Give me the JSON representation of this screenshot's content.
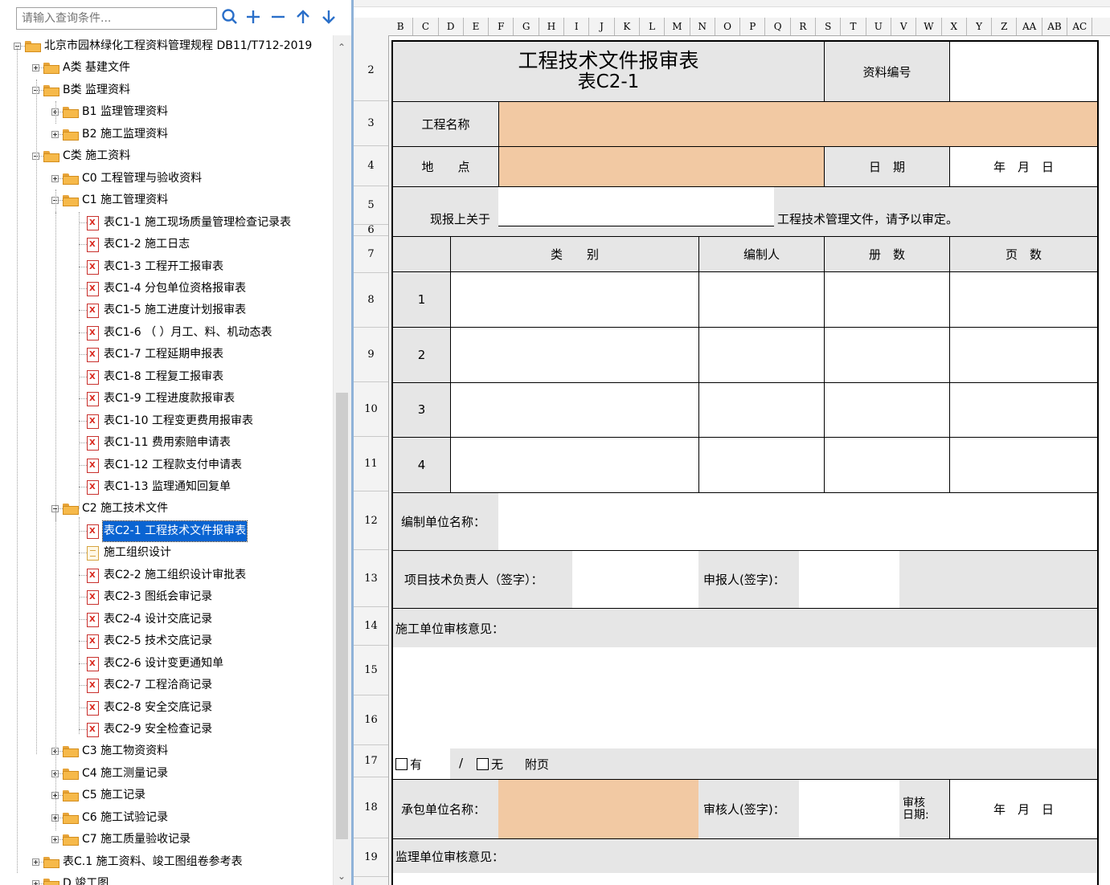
{
  "search": {
    "placeholder": "请输入查询条件..."
  },
  "toolbar": {
    "icons": [
      "search-icon",
      "add-icon",
      "remove-icon",
      "move-up-icon",
      "move-down-icon"
    ],
    "buttons": [
      "搜索",
      "添加",
      "删除",
      "上移",
      "下移"
    ]
  },
  "tree": {
    "nodes": [
      {
        "label": "北京市园林绿化工程资料管理规程 DB11/T712-2019",
        "level": 0,
        "icon": "folder-open-icon",
        "expanded": true
      },
      {
        "label": "A类 基建文件",
        "level": 1,
        "icon": "folder-icon",
        "expanded": false
      },
      {
        "label": "B类 监理资料",
        "level": 1,
        "icon": "folder-open-icon",
        "expanded": true
      },
      {
        "label": "B1 监理管理资料",
        "level": 2,
        "icon": "folder-icon",
        "expanded": false
      },
      {
        "label": "B2 施工监理资料",
        "level": 2,
        "icon": "folder-icon",
        "expanded": false
      },
      {
        "label": "C类 施工资料",
        "level": 1,
        "icon": "folder-open-icon",
        "expanded": true
      },
      {
        "label": "C0 工程管理与验收资料",
        "level": 2,
        "icon": "folder-icon",
        "expanded": false
      },
      {
        "label": "C1 施工管理资料",
        "level": 2,
        "icon": "folder-open-icon",
        "expanded": true
      },
      {
        "label": "表C1-1 施工现场质量管理检查记录表",
        "level": 3,
        "icon": "pdf-icon"
      },
      {
        "label": "表C1-2 施工日志",
        "level": 3,
        "icon": "pdf-icon"
      },
      {
        "label": "表C1-3 工程开工报审表",
        "level": 3,
        "icon": "pdf-icon"
      },
      {
        "label": "表C1-4 分包单位资格报审表",
        "level": 3,
        "icon": "pdf-icon"
      },
      {
        "label": "表C1-5 施工进度计划报审表",
        "level": 3,
        "icon": "pdf-icon"
      },
      {
        "label": "表C1-6 （ ）月工、料、机动态表",
        "level": 3,
        "icon": "pdf-icon"
      },
      {
        "label": "表C1-7 工程延期申报表",
        "level": 3,
        "icon": "pdf-icon"
      },
      {
        "label": "表C1-8 工程复工报审表",
        "level": 3,
        "icon": "pdf-icon"
      },
      {
        "label": "表C1-9 工程进度款报审表",
        "level": 3,
        "icon": "pdf-icon"
      },
      {
        "label": "表C1-10 工程变更费用报审表",
        "level": 3,
        "icon": "pdf-icon"
      },
      {
        "label": "表C1-11 费用索赔申请表",
        "level": 3,
        "icon": "pdf-icon"
      },
      {
        "label": "表C1-12 工程款支付申请表",
        "level": 3,
        "icon": "pdf-icon"
      },
      {
        "label": "表C1-13 监理通知回复单",
        "level": 3,
        "icon": "pdf-icon"
      },
      {
        "label": "C2 施工技术文件",
        "level": 2,
        "icon": "folder-open-icon",
        "expanded": true
      },
      {
        "label": "表C2-1 工程技术文件报审表",
        "level": 3,
        "icon": "pdf-icon",
        "selected": true
      },
      {
        "label": "施工组织设计",
        "level": 3,
        "icon": "document-icon"
      },
      {
        "label": "表C2-2 施工组织设计审批表",
        "level": 3,
        "icon": "pdf-icon"
      },
      {
        "label": "表C2-3 图纸会审记录",
        "level": 3,
        "icon": "pdf-icon"
      },
      {
        "label": "表C2-4 设计交底记录",
        "level": 3,
        "icon": "pdf-icon"
      },
      {
        "label": "表C2-5 技术交底记录",
        "level": 3,
        "icon": "pdf-icon"
      },
      {
        "label": "表C2-6 设计变更通知单",
        "level": 3,
        "icon": "pdf-icon"
      },
      {
        "label": "表C2-7 工程洽商记录",
        "level": 3,
        "icon": "pdf-icon"
      },
      {
        "label": "表C2-8 安全交底记录",
        "level": 3,
        "icon": "pdf-icon"
      },
      {
        "label": "表C2-9 安全检查记录",
        "level": 3,
        "icon": "pdf-icon"
      },
      {
        "label": "C3 施工物资资料",
        "level": 2,
        "icon": "folder-icon",
        "expanded": false
      },
      {
        "label": "C4 施工测量记录",
        "level": 2,
        "icon": "folder-icon",
        "expanded": false
      },
      {
        "label": "C5 施工记录",
        "level": 2,
        "icon": "folder-icon",
        "expanded": false
      },
      {
        "label": "C6 施工试验记录",
        "level": 2,
        "icon": "folder-icon",
        "expanded": false
      },
      {
        "label": "C7 施工质量验收记录",
        "level": 2,
        "icon": "folder-icon",
        "expanded": false
      },
      {
        "label": "表C.1 施工资料、竣工图组卷参考表",
        "level": 1,
        "icon": "folder-icon",
        "expanded": false
      },
      {
        "label": "D 竣工图",
        "level": 1,
        "icon": "folder-icon",
        "expanded": false
      }
    ]
  },
  "sheet": {
    "columns": [
      "B",
      "C",
      "D",
      "E",
      "F",
      "G",
      "H",
      "I",
      "J",
      "K",
      "L",
      "M",
      "N",
      "O",
      "P",
      "Q",
      "R",
      "S",
      "T",
      "U",
      "V",
      "W",
      "X",
      "Y",
      "Z",
      "AA",
      "AB",
      "AC"
    ],
    "rows": [
      "2",
      "3",
      "4",
      "5",
      "6",
      "7",
      "8",
      "9",
      "10",
      "11",
      "12",
      "13",
      "14",
      "15",
      "16",
      "17",
      "18",
      "19"
    ]
  },
  "form": {
    "title": "工程技术文件报审表",
    "subtitle": "表C2-1",
    "doc_no_label": "资料编号",
    "project_name_label": "工程名称",
    "location_label": "地　　点",
    "date_label": "日　期",
    "date_placeholder": "年　月　日",
    "report_prefix": "现报上关于",
    "report_suffix": "工程技术管理文件，请予以审定。",
    "headers": {
      "index": "",
      "category": "类　　别",
      "author": "编制人",
      "volumes": "册　数",
      "pages": "页　数"
    },
    "items": [
      "1",
      "2",
      "3",
      "4"
    ],
    "compile_unit_label": "编制单位名称：",
    "tech_lead_label": "项目技术负责人（签字）：",
    "reporter_label": "申报人(签字)：",
    "contractor_opinion_label": "施工单位审核意见：",
    "has_label": "有",
    "slash": "/",
    "none_label": "无",
    "attachment_label": "附页",
    "contractor_unit_label": "承包单位名称：",
    "reviewer_label": "审核人(签字)：",
    "review_date_label": "审核\n日期:",
    "review_date_placeholder": "年　月　日",
    "supervisor_opinion_label": "监理单位审核意见："
  }
}
